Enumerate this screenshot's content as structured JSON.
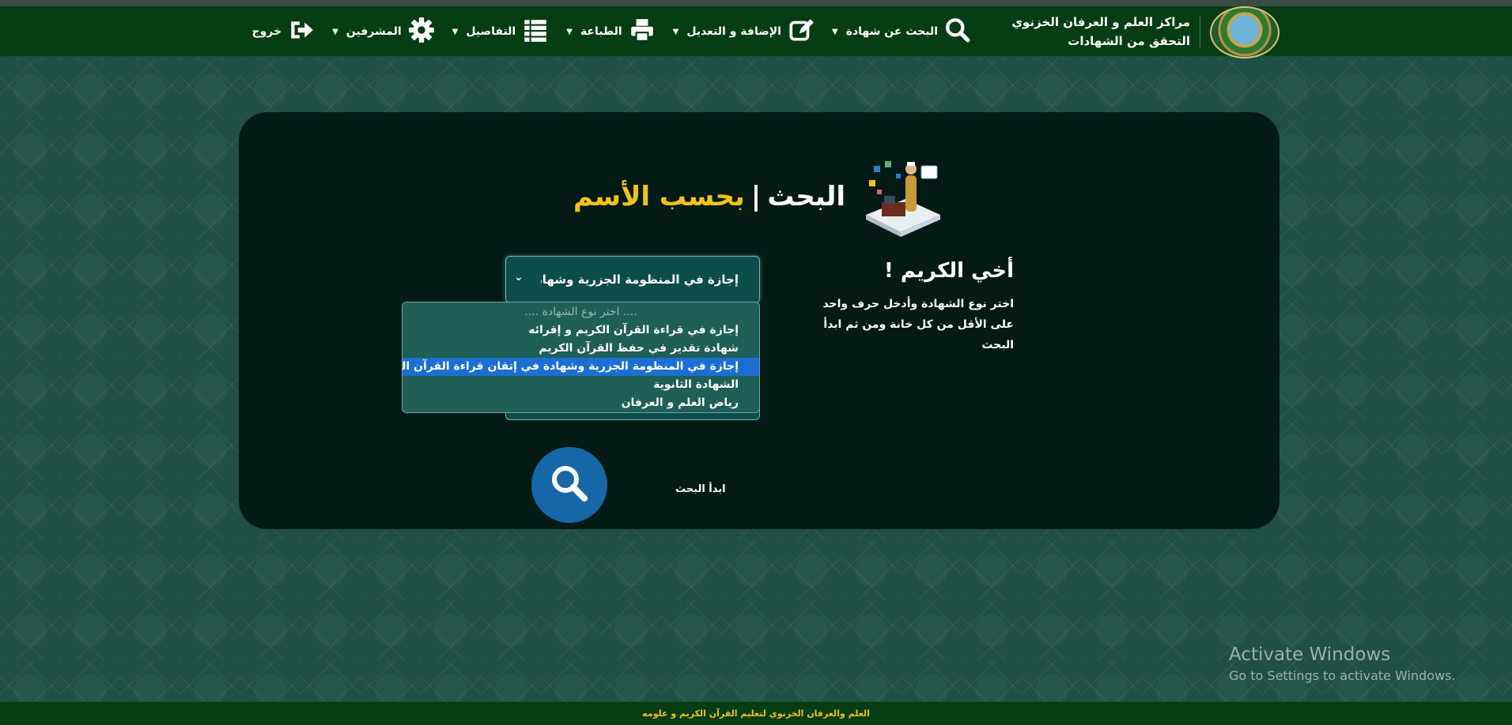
{
  "brand": {
    "title": "مراكز العلم و العرفان الخزنوي",
    "subtitle": "التحقق من الشهادات",
    "logo_icon": "organization-seal-logo"
  },
  "nav": {
    "items": [
      {
        "label": "البحث عن شهادة",
        "icon": "search-icon",
        "has_caret": true
      },
      {
        "label": "الإضافة و التعديل",
        "icon": "edit-icon",
        "has_caret": true
      },
      {
        "label": "الطباعة",
        "icon": "printer-icon",
        "has_caret": true
      },
      {
        "label": "التفاصيل",
        "icon": "list-icon",
        "has_caret": true
      },
      {
        "label": "المشرفين",
        "icon": "gear-icon",
        "has_caret": true
      },
      {
        "label": "خروج",
        "icon": "logout-icon",
        "has_caret": false
      }
    ]
  },
  "main": {
    "heading": {
      "part1": "البحث",
      "separator": "|",
      "part2": "بحسب الأسم"
    },
    "greeting": {
      "title": "أخي الكريم !",
      "text": "اختر نوع الشهادة وأدخل حرف واحد على الأقل من كل خانة ومن ثم ابدأ البحث"
    },
    "select": {
      "value": "إجازة في المنظومة الجزرية وشهادة في إتقان قراءة القرآن الكريم",
      "options": [
        {
          "label": ".... اختر نوع الشهادة ....",
          "placeholder": true
        },
        {
          "label": "إجازة في قراءة القرآن الكريم و إقرائه"
        },
        {
          "label": "شهادة تقدير في حفظ القرآن الكريم"
        },
        {
          "label": "إجازة في المنظومة الجزرية وشهادة في إتقان قراءة القرآن الكريم",
          "selected": true
        },
        {
          "label": "الشهادة الثانوية"
        },
        {
          "label": "رياض العلم و العرفان"
        }
      ]
    },
    "search_button": {
      "label": "ابدأ البحث",
      "icon": "search-icon"
    }
  },
  "watermark": {
    "line1": "Activate Windows",
    "line2": "Go to Settings to activate Windows."
  },
  "footer": {
    "text": "العلم والعرفان الخزنوي لتعليم القرآن الكريم و علومه"
  },
  "colors": {
    "navbar": "#063d13",
    "card": "#041a15",
    "accent": "#f1c21b",
    "selected": "#1b6fd2",
    "button": "#1667a7"
  }
}
